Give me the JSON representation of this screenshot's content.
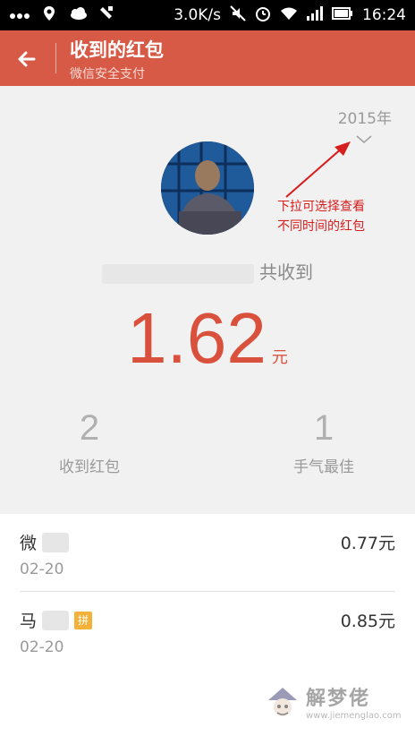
{
  "status_bar": {
    "speed": "3.0K/s",
    "time": "16:24",
    "icons": [
      "dots-icon",
      "location-icon",
      "weather-icon",
      "notification-icon",
      "mute-icon",
      "alarm-icon",
      "wifi-icon",
      "signal-icon",
      "battery-icon"
    ]
  },
  "header": {
    "title": "收到的红包",
    "subtitle": "微信安全支付",
    "color": "#d65a46"
  },
  "summary": {
    "year": "2015年",
    "received_suffix": "共收到",
    "total_amount": "1.62",
    "unit": "元",
    "annotation_line1": "下拉可选择查看",
    "annotation_line2": "不同时间的红包",
    "stats": [
      {
        "value": "2",
        "label": "收到红包"
      },
      {
        "value": "1",
        "label": "手气最佳"
      }
    ]
  },
  "records": [
    {
      "name": "微",
      "date": "02-20",
      "amount": "0.77元",
      "badge": ""
    },
    {
      "name": "马",
      "date": "02-20",
      "amount": "0.85元",
      "badge": "拼"
    }
  ],
  "watermark": {
    "text": "解梦佬",
    "url": "www.jiemenglao.com"
  }
}
